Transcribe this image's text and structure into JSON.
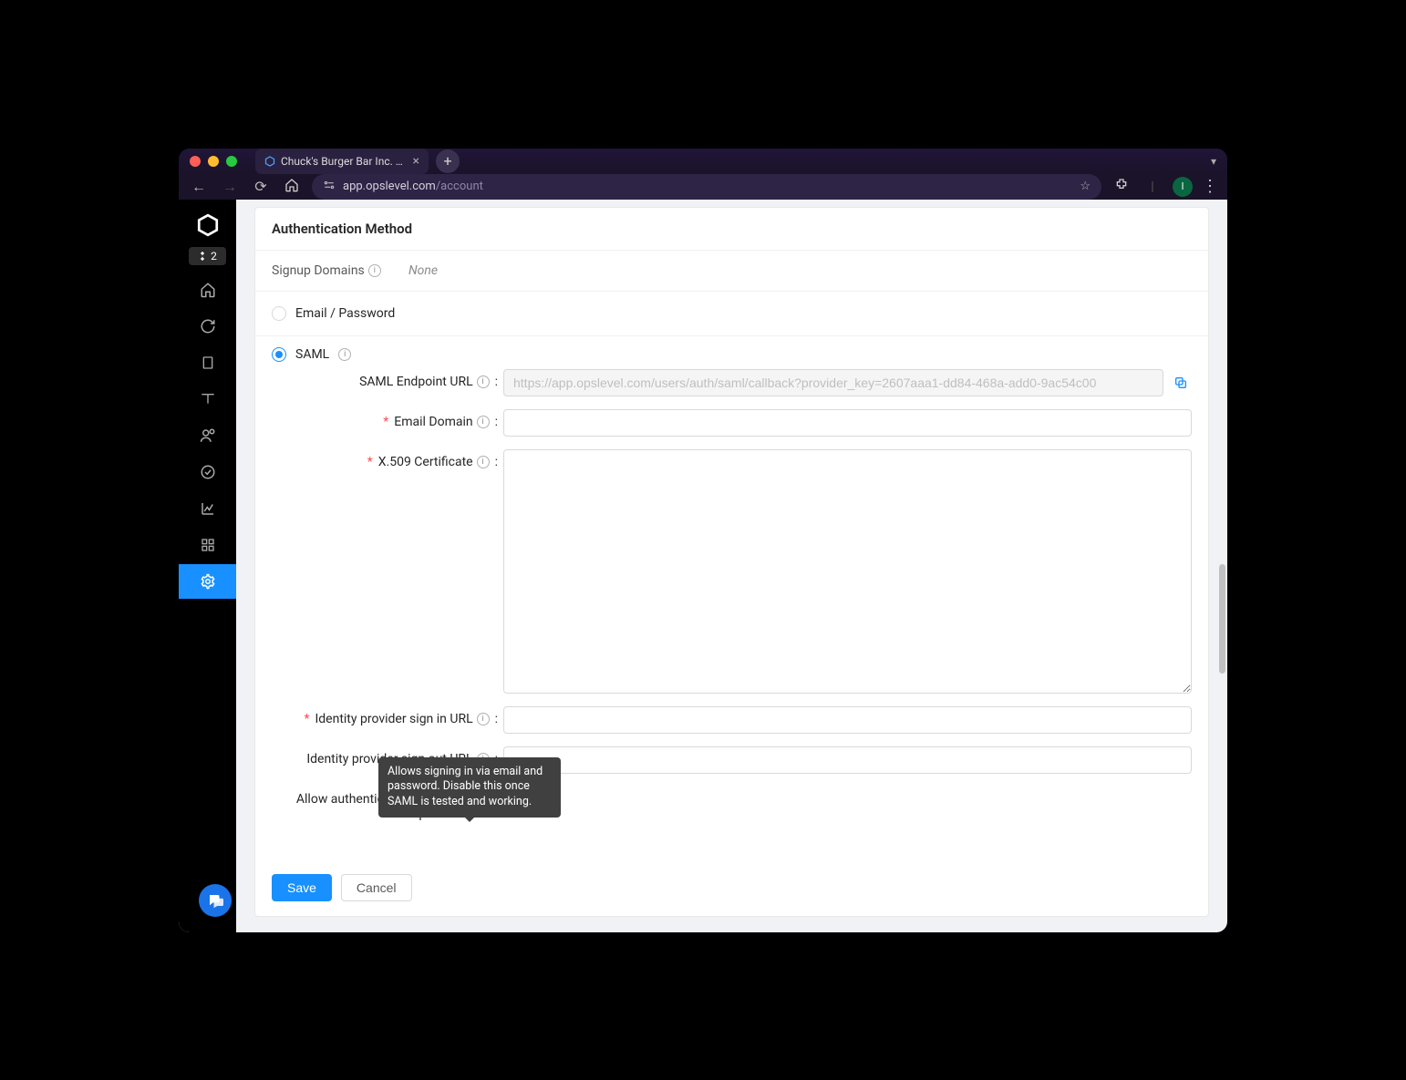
{
  "browser": {
    "tab_title": "Chuck's Burger Bar Inc. - Acc…",
    "url_host": "app.opslevel.com",
    "url_path": "/account",
    "avatar_initial": "I"
  },
  "sidebar": {
    "badge_count": "2"
  },
  "card": {
    "title": "Authentication Method",
    "signup_domains_label": "Signup Domains",
    "signup_domains_value": "None"
  },
  "auth_options": {
    "email_password_label": "Email / Password",
    "saml_label": "SAML"
  },
  "saml": {
    "endpoint_label": "SAML Endpoint URL",
    "endpoint_value": "https://app.opslevel.com/users/auth/saml/callback?provider_key=2607aaa1-dd84-468a-add0-9ac54c00",
    "email_domain_label": "Email Domain",
    "email_domain_value": "",
    "cert_label": "X.509 Certificate",
    "cert_value": "",
    "signin_url_label": "Identity provider sign in URL",
    "signin_url_value": "",
    "signout_url_label": "Identity provider sign out URL",
    "signout_url_value": "",
    "allow_email_label": "Allow authentication via email / password",
    "tooltip_text": "Allows signing in via email and password. Disable this once SAML is tested and working."
  },
  "actions": {
    "save_label": "Save",
    "cancel_label": "Cancel"
  }
}
